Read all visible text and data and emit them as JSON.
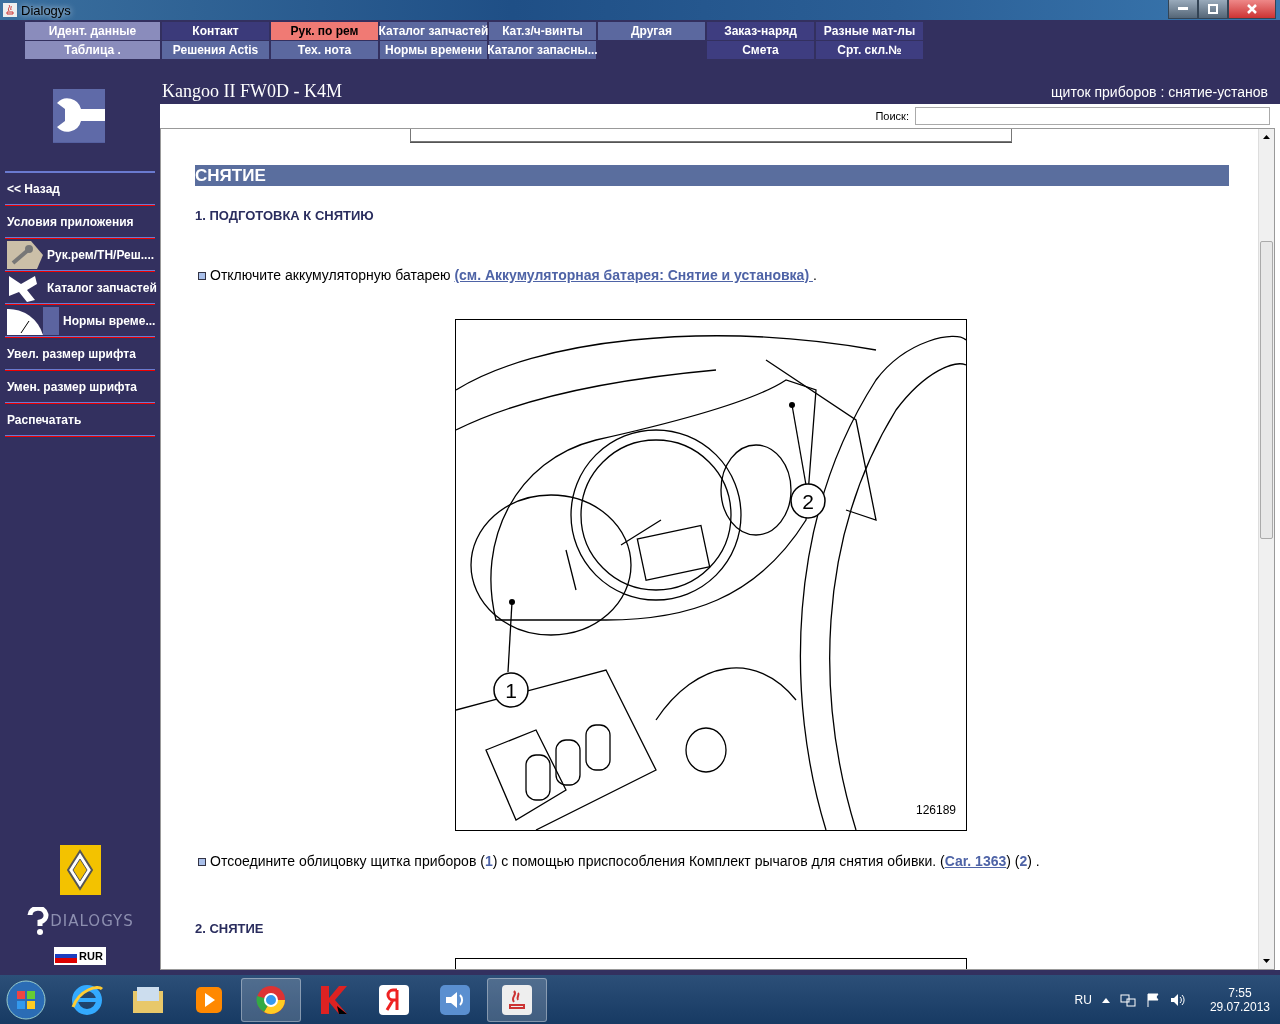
{
  "window": {
    "title": "Dialogys"
  },
  "menu": {
    "rows": [
      [
        {
          "label": "Идент. данные",
          "selected": false,
          "color": "#8a8cbc"
        },
        {
          "label": "Контакт",
          "selected": false,
          "color": "#3b3a7a"
        },
        {
          "label": "Рук. по рем",
          "selected": true,
          "color": "#f07a74"
        },
        {
          "label": "Каталог запчастей",
          "selected": false,
          "color": "#5b689f"
        },
        {
          "label": "Кат.з/ч-винты",
          "selected": false,
          "color": "#5b689f"
        },
        {
          "label": "Другая",
          "selected": false,
          "color": "#5b689f"
        },
        {
          "label": "Заказ-наряд",
          "selected": false,
          "color": "#3e3d80"
        },
        {
          "label": "Разные мат-лы",
          "selected": false,
          "color": "#3e3d80"
        }
      ],
      [
        {
          "label": "Таблица .",
          "selected": false,
          "color": "#8a8cbc"
        },
        {
          "label": "Решения Actis",
          "selected": false,
          "color": "#5b689f"
        },
        {
          "label": "Тех. нота",
          "selected": false,
          "color": "#5b689f"
        },
        {
          "label": "Нормы времени",
          "selected": false,
          "color": "#5b689f"
        },
        {
          "label": "Каталог запасны...",
          "selected": false,
          "color": "#5b689f"
        },
        null,
        {
          "label": "Смета",
          "selected": false,
          "color": "#3e3d80"
        },
        {
          "label": "Срт. скл.№",
          "selected": false,
          "color": "#3e3d80"
        }
      ]
    ]
  },
  "header": {
    "vehicle": "Kangoo II FW0D - K4M",
    "topic": "щиток приборов : снятие-установ"
  },
  "sidebar": {
    "items": [
      {
        "label": "<< Назад",
        "kind": "text"
      },
      {
        "label": "Условия приложения",
        "kind": "text"
      },
      {
        "label": "Рук.рем/ТН/Реш....",
        "kind": "wrench"
      },
      {
        "label": "Каталог запчастей",
        "kind": "parts"
      },
      {
        "label": "Нормы време...",
        "kind": "clock"
      },
      {
        "label": "Увел. размер шрифта",
        "kind": "text"
      },
      {
        "label": "Умен. размер шрифта",
        "kind": "text"
      },
      {
        "label": "Распечатать",
        "kind": "text"
      }
    ],
    "brand": "DIALOGYS",
    "currency": "RUR"
  },
  "search": {
    "label": "Поиск:"
  },
  "document": {
    "section": "СНЯТИЕ",
    "blocks": [
      {
        "kind": "heading",
        "text": "1. ПОДГОТОВКА К СНЯТИЮ"
      },
      {
        "kind": "bullet",
        "parts": [
          {
            "kind": "plain",
            "text": "Отключите аккумуляторную батарею "
          },
          {
            "kind": "link",
            "text": "(см. Аккумуляторная батарея: Снятие и установка) "
          },
          {
            "kind": "plain",
            "text": "."
          }
        ]
      },
      {
        "kind": "figure",
        "number": "126189",
        "callouts": [
          "1",
          "2"
        ]
      },
      {
        "kind": "bullet",
        "parts": [
          {
            "kind": "plain",
            "text": "Отсоедините облицовку щитка приборов ("
          },
          {
            "kind": "ref",
            "text": "1"
          },
          {
            "kind": "plain",
            "text": ") с помощью приспособления Комплект рычагов для снятия обивки. ("
          },
          {
            "kind": "link",
            "text": "Car. 1363"
          },
          {
            "kind": "plain",
            "text": ") ("
          },
          {
            "kind": "ref",
            "text": "2"
          },
          {
            "kind": "plain",
            "text": ") ."
          }
        ]
      },
      {
        "kind": "heading",
        "text": "2. СНЯТИЕ"
      },
      {
        "kind": "figure-cut"
      }
    ]
  },
  "taskbar": {
    "language": "RU",
    "time": "7:55",
    "date": "29.07.2013"
  }
}
